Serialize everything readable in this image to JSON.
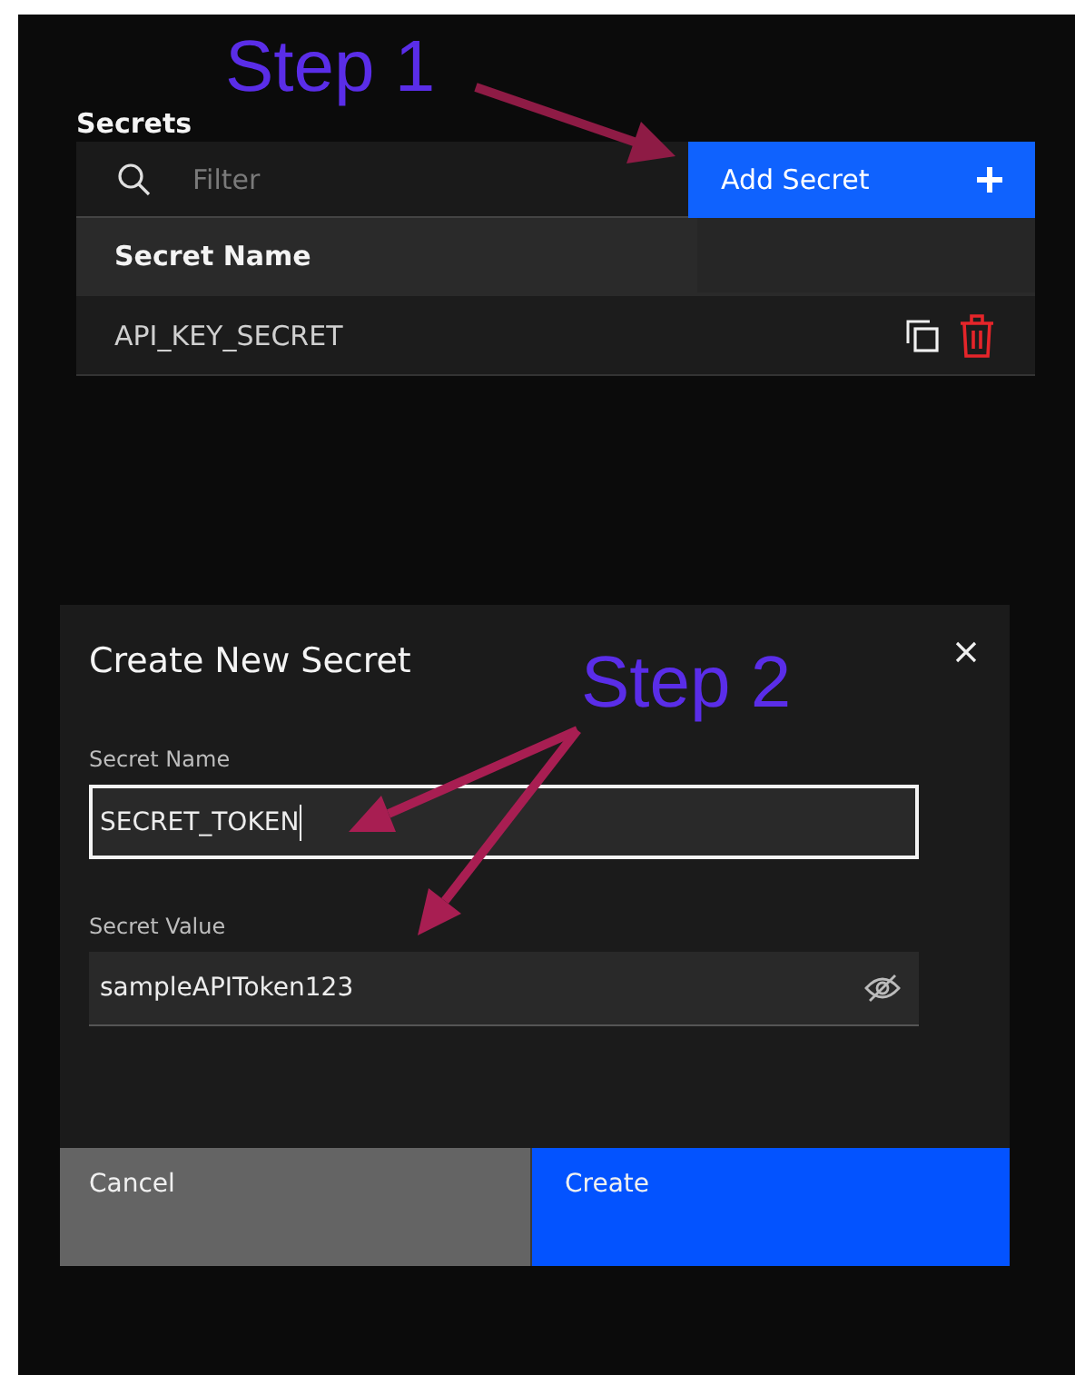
{
  "secrets": {
    "title": "Secrets",
    "filter": {
      "placeholder": "Filter"
    },
    "add_button": {
      "label": "Add Secret"
    },
    "columns": [
      "Secret Name"
    ],
    "rows": [
      {
        "name": "API_KEY_SECRET"
      }
    ]
  },
  "modal": {
    "title": "Create New Secret",
    "fields": [
      {
        "label": "Secret Name",
        "value": "SECRET_TOKEN",
        "focused": true,
        "kind": "text"
      },
      {
        "label": "Secret Value",
        "value": "sampleAPIToken123",
        "focused": false,
        "kind": "password"
      }
    ],
    "buttons": [
      {
        "label": "Cancel",
        "kind": "secondary"
      },
      {
        "label": "Create",
        "kind": "primary"
      }
    ]
  },
  "annotations": [
    {
      "label": "Step 1"
    },
    {
      "label": "Step 2"
    }
  ]
}
